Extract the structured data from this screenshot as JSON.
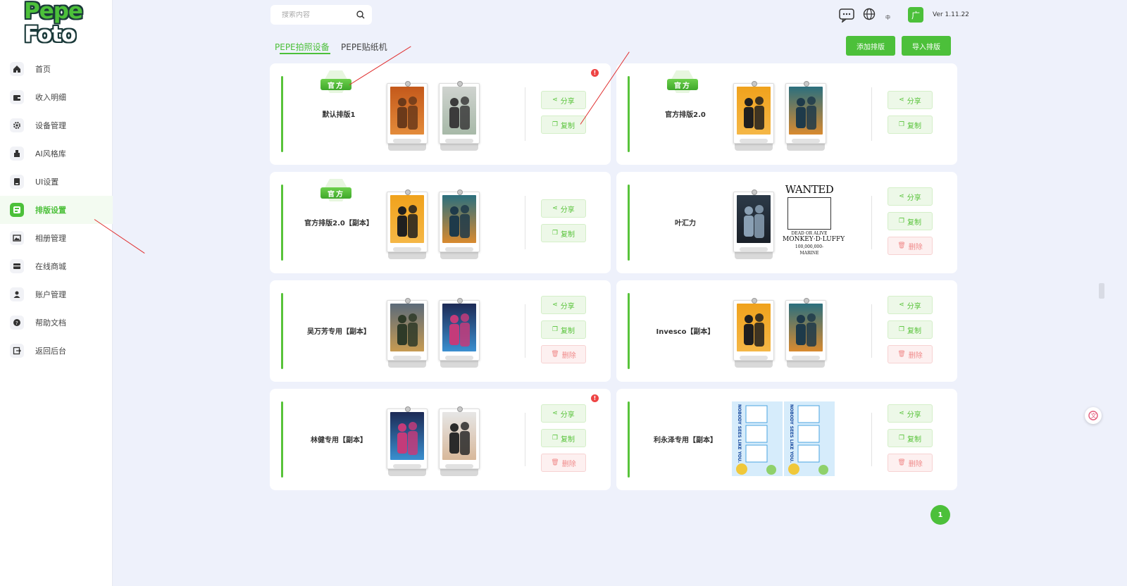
{
  "logo": {
    "line1": "Pepe",
    "line2": "Foto"
  },
  "sidebar": {
    "items": [
      {
        "label": "首页",
        "icon": "home-icon"
      },
      {
        "label": "收入明细",
        "icon": "wallet-icon"
      },
      {
        "label": "设备管理",
        "icon": "gear-icon"
      },
      {
        "label": "AI风格库",
        "icon": "ai-style-icon"
      },
      {
        "label": "UI设置",
        "icon": "ui-settings-icon"
      },
      {
        "label": "排版设置",
        "icon": "layout-icon",
        "active": true
      },
      {
        "label": "相册管理",
        "icon": "album-icon"
      },
      {
        "label": "在线商城",
        "icon": "store-icon"
      },
      {
        "label": "账户管理",
        "icon": "user-icon"
      },
      {
        "label": "帮助文档",
        "icon": "help-icon"
      },
      {
        "label": "返回后台",
        "icon": "exit-icon"
      }
    ]
  },
  "header": {
    "search_placeholder": "搜索内容",
    "lang_label": "中",
    "ad_label": "广",
    "version": "Ver 1.11.22"
  },
  "tabs": [
    {
      "label": "PEPE拍照设备",
      "active": true
    },
    {
      "label": "PEPE贴纸机",
      "active": false
    }
  ],
  "buttons": {
    "add_layout": "添加排版",
    "import_layout": "导入排版"
  },
  "actions": {
    "share": "分享",
    "copy": "复制",
    "delete": "删除"
  },
  "official_badge": "官方",
  "cards": [
    {
      "name": "默认排版1",
      "official": true,
      "alert": true,
      "deletable": false,
      "thumbs": [
        "orange-portrait",
        "grey-portrait"
      ]
    },
    {
      "name": "官方排版2.0",
      "official": true,
      "alert": false,
      "deletable": false,
      "thumbs": [
        "orange-couple",
        "teal-couple"
      ]
    },
    {
      "name": "官方排版2.0【副本】",
      "official": true,
      "alert": false,
      "deletable": false,
      "thumbs": [
        "orange-couple",
        "teal-couple"
      ]
    },
    {
      "name": "叶汇力",
      "official": false,
      "alert": false,
      "deletable": true,
      "thumbs": [
        "man-jacket",
        "wanted-poster"
      ]
    },
    {
      "name": "吴万芳专用【副本】",
      "official": false,
      "alert": false,
      "deletable": true,
      "thumbs": [
        "city-couple",
        "neon-couple"
      ]
    },
    {
      "name": "Invesco【副本】",
      "official": false,
      "alert": false,
      "deletable": true,
      "thumbs": [
        "orange-couple",
        "teal-couple"
      ]
    },
    {
      "name": "林健专用【副本】",
      "official": false,
      "alert": true,
      "deletable": true,
      "thumbs": [
        "neon-couple",
        "man-suit"
      ]
    },
    {
      "name": "利永泽专用【副本】",
      "official": false,
      "alert": false,
      "deletable": true,
      "thumbs": [
        "nobody-strip",
        "nobody-strip"
      ]
    }
  ],
  "wanted": {
    "title": "WANTED",
    "subtitle": "DEAD OR ALIVE",
    "name": "MONKEY·D·LUFFY",
    "bounty": "100,000,000-",
    "footer": "MARINE"
  },
  "strip": {
    "text": "NOBODY SEES LIKE YOU."
  },
  "pagination": {
    "current": "1"
  },
  "colors": {
    "accent": "#4cc03a",
    "danger": "#f08a8a",
    "background": "#eef1fb"
  }
}
